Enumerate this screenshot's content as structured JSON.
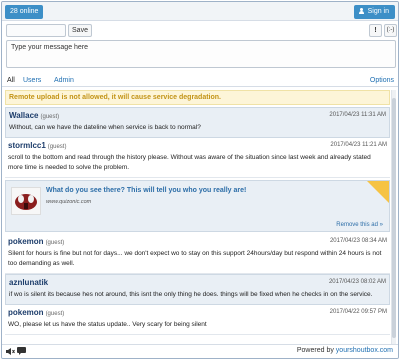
{
  "header": {
    "online_label": "28 online",
    "signin_label": "Sign in"
  },
  "compose": {
    "name_value": "",
    "save_label": "Save",
    "bell_label": "!",
    "smiley_label": "(:-)",
    "message_placeholder": "Type your message here"
  },
  "tabs": {
    "all": "All",
    "users": "Users",
    "admin": "Admin",
    "options": "Options"
  },
  "warning": "Remote upload is not allowed, it will cause service degradation.",
  "messages": [
    {
      "author": "Wallace",
      "role": "(guest)",
      "time": "2017/04/23 11:31 AM",
      "text": "Without, can we have the dateline when service is back to normal?"
    },
    {
      "author": "stormlcc1",
      "role": "(guest)",
      "time": "2017/04/23 11:21 AM",
      "text": "scroll to the bottom and read through the history please. Without was aware of the situation since last week and already stated more time is needed to solve the problem."
    },
    {
      "author": "pokemon",
      "role": "(guest)",
      "time": "2017/04/23 08:34 AM",
      "text": "Silent for hours is fine but not for days... we don't expect wo to stay on this support 24hours/day but respond within 24 hours is not too demanding as well."
    },
    {
      "author": "aznlunatik",
      "role": "",
      "time": "2017/04/23 08:02 AM",
      "text": "if wo is silent its because hes not around, this isnt the only thing he does. things will be fixed when he checks in on the service."
    },
    {
      "author": "pokemon",
      "role": "(guest)",
      "time": "2017/04/22 09:57 PM",
      "text": "WO, please let us have the status update.. Very scary for being silent"
    }
  ],
  "ad": {
    "title": "What do you see there? This will tell you who you really are!",
    "domain": "www.quizonic.com",
    "remove_label": "Remove this ad »"
  },
  "footer": {
    "powered_prefix": "Powered by",
    "powered_link": "yourshoutbox.com"
  },
  "colors": {
    "accent": "#3d8fc7",
    "warning_text": "#c39417",
    "link": "#1f6fb2"
  }
}
